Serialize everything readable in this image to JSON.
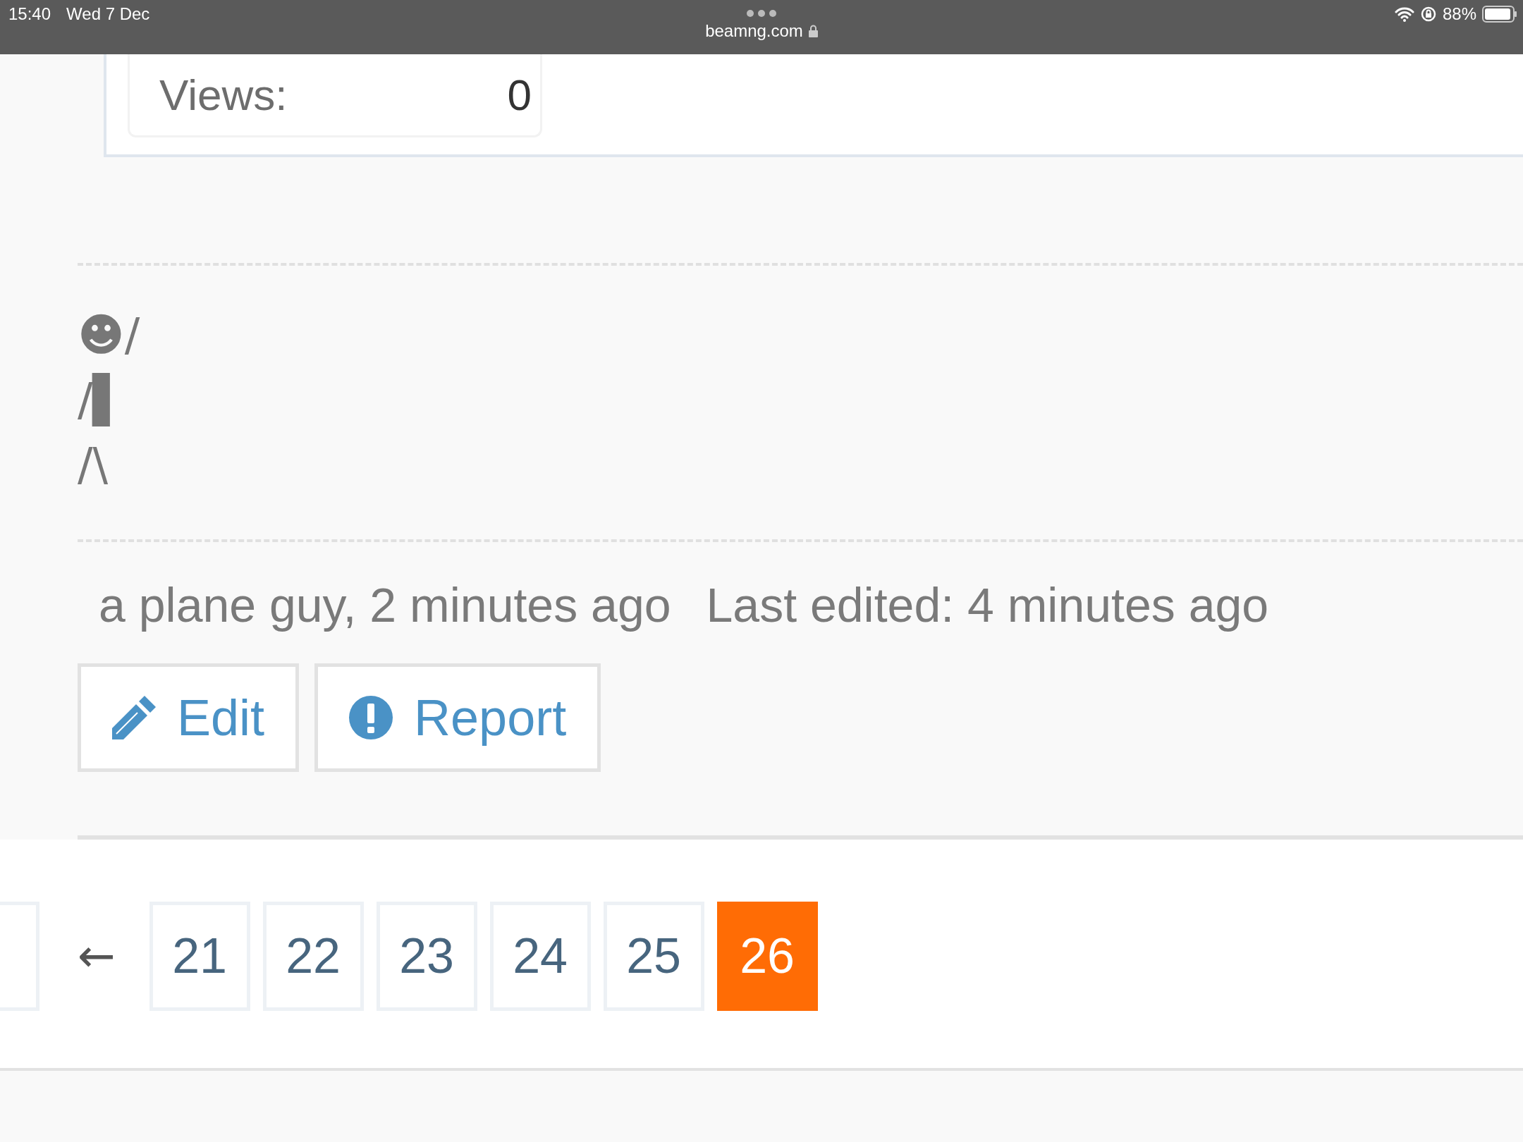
{
  "status_bar": {
    "time": "15:40",
    "date": "Wed 7 Dec",
    "url": "beamng.com",
    "battery": "88%"
  },
  "stats": {
    "label": "Views:",
    "value": "0"
  },
  "post": {
    "lines": [
      "☻/",
      "/▌",
      "/\\"
    ],
    "author": "a plane guy, 2 minutes ago",
    "edited": "Last edited: 4 minutes ago"
  },
  "actions": [
    {
      "kind": "edit",
      "label": "Edit"
    },
    {
      "kind": "report",
      "label": "Report"
    }
  ],
  "pagination": {
    "prev": "←",
    "pages": [
      {
        "label": "21",
        "selected": false
      },
      {
        "label": "22",
        "selected": false
      },
      {
        "label": "23",
        "selected": false
      },
      {
        "label": "24",
        "selected": false
      },
      {
        "label": "25",
        "selected": false
      },
      {
        "label": "26",
        "selected": true
      }
    ]
  }
}
